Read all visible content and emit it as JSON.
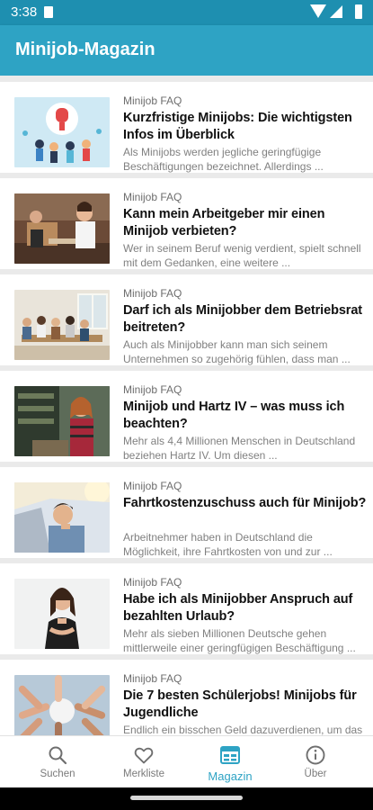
{
  "status_bar": {
    "time": "3:38"
  },
  "app_bar": {
    "title": "Minijob-Magazin"
  },
  "articles": [
    {
      "category": "Minijob FAQ",
      "title": "Kurzfristige Minijobs: Die wichtigsten Infos im Überblick",
      "excerpt": "Als Minijobs werden jegliche geringfügige Beschäftigungen bezeichnet. Allerdings ..."
    },
    {
      "category": "Minijob FAQ",
      "title": "Kann mein Arbeitgeber mir einen Minijob verbieten?",
      "excerpt": "Wer in seinem Beruf wenig verdient, spielt schnell mit dem Gedanken, eine weitere ..."
    },
    {
      "category": "Minijob FAQ",
      "title": "Darf ich als Minijobber dem Betriebsrat beitreten?",
      "excerpt": "Auch als Minijobber kann man sich seinem Unternehmen so zugehörig fühlen, dass man ..."
    },
    {
      "category": "Minijob FAQ",
      "title": "Minijob und Hartz IV – was muss ich beachten?",
      "excerpt": "Mehr als 4,4 Millionen Menschen in Deutschland beziehen Hartz IV. Um diesen ..."
    },
    {
      "category": "Minijob FAQ",
      "title": "Fahrtkostenzuschuss auch für Minijob?",
      "excerpt": "Arbeitnehmer haben in Deutschland die Möglichkeit, ihre Fahrtkosten von und zur ..."
    },
    {
      "category": "Minijob FAQ",
      "title": "Habe ich als Minijobber Anspruch auf bezahlten Urlaub?",
      "excerpt": "Mehr als sieben Millionen Deutsche gehen mittlerweile einer geringfügigen Beschäftigung ..."
    },
    {
      "category": "Minijob FAQ",
      "title": "Die 7 besten Schülerjobs! Minijobs für Jugendliche",
      "excerpt": "Endlich ein bisschen Geld dazuverdienen, um das neue Taschengeld aufzustocken. Davon ..."
    }
  ],
  "bottom_nav": {
    "items": [
      {
        "label": "Suchen",
        "icon": "search-icon"
      },
      {
        "label": "Merkliste",
        "icon": "heart-icon"
      },
      {
        "label": "Magazin",
        "icon": "magazine-icon",
        "active": true
      },
      {
        "label": "Über",
        "icon": "info-icon"
      }
    ]
  },
  "colors": {
    "accent": "#2ea3c4",
    "status_bar": "#1e8fb0"
  }
}
